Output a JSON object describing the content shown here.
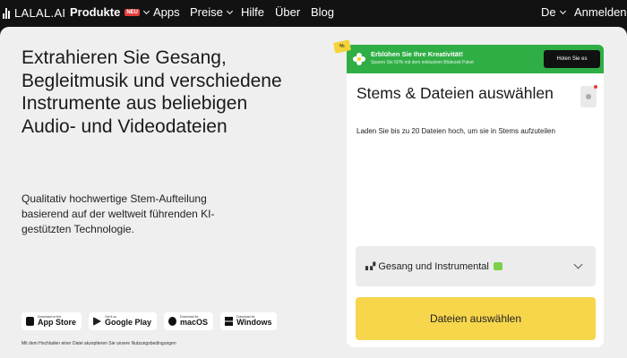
{
  "nav": {
    "logo_text": "LALAL.AI",
    "items": [
      {
        "label": "Produkte",
        "badge": "NEU"
      },
      {
        "label": "Apps"
      },
      {
        "label": "Preise"
      },
      {
        "label": "Hilfe"
      },
      {
        "label": "Über"
      },
      {
        "label": "Blog"
      }
    ],
    "language": "De",
    "login": "Anmelden"
  },
  "hero": {
    "title": "Extrahieren Sie Gesang, Begleitmusik und verschiedene Instrumente aus beliebigen Audio- und Videodateien",
    "subtitle": "Qualitativ hochwertige Stem-Aufteilung basierend auf der weltweit führenden KI-gestützten Technologie."
  },
  "stores": [
    {
      "small": "Download on the",
      "big": "App Store",
      "icon": "apple-icon"
    },
    {
      "small": "Get it on",
      "big": "Google Play",
      "icon": "google-play-icon"
    },
    {
      "small": "Download for",
      "big": "macOS",
      "icon": "macos-icon"
    },
    {
      "small": "Download for",
      "big": "Windows",
      "icon": "windows-icon"
    }
  ],
  "terms": "Mit dem Hochladen einer Datei akzeptieren Sie unsere Nutzungsbedingungen",
  "promo": {
    "tag": "%",
    "title": "Erblühen Sie Ihre Kreativität!",
    "text": "Sparen Sie 50% mit dem exklusiven Blütezeit Paket",
    "button": "Holen Sie es"
  },
  "card": {
    "title": "Stems & Dateien auswählen",
    "description": "Laden Sie bis zu 20 Dateien hoch, um sie in Stems aufzuteilen",
    "mode_label": "Gesang und Instrumental",
    "choose_button": "Dateien auswählen"
  },
  "colors": {
    "nav_bg": "#121212",
    "main_bg": "#efefef",
    "promo_green": "#2fae45",
    "accent_yellow": "#f7d64c",
    "badge_red": "#e23b3b"
  }
}
